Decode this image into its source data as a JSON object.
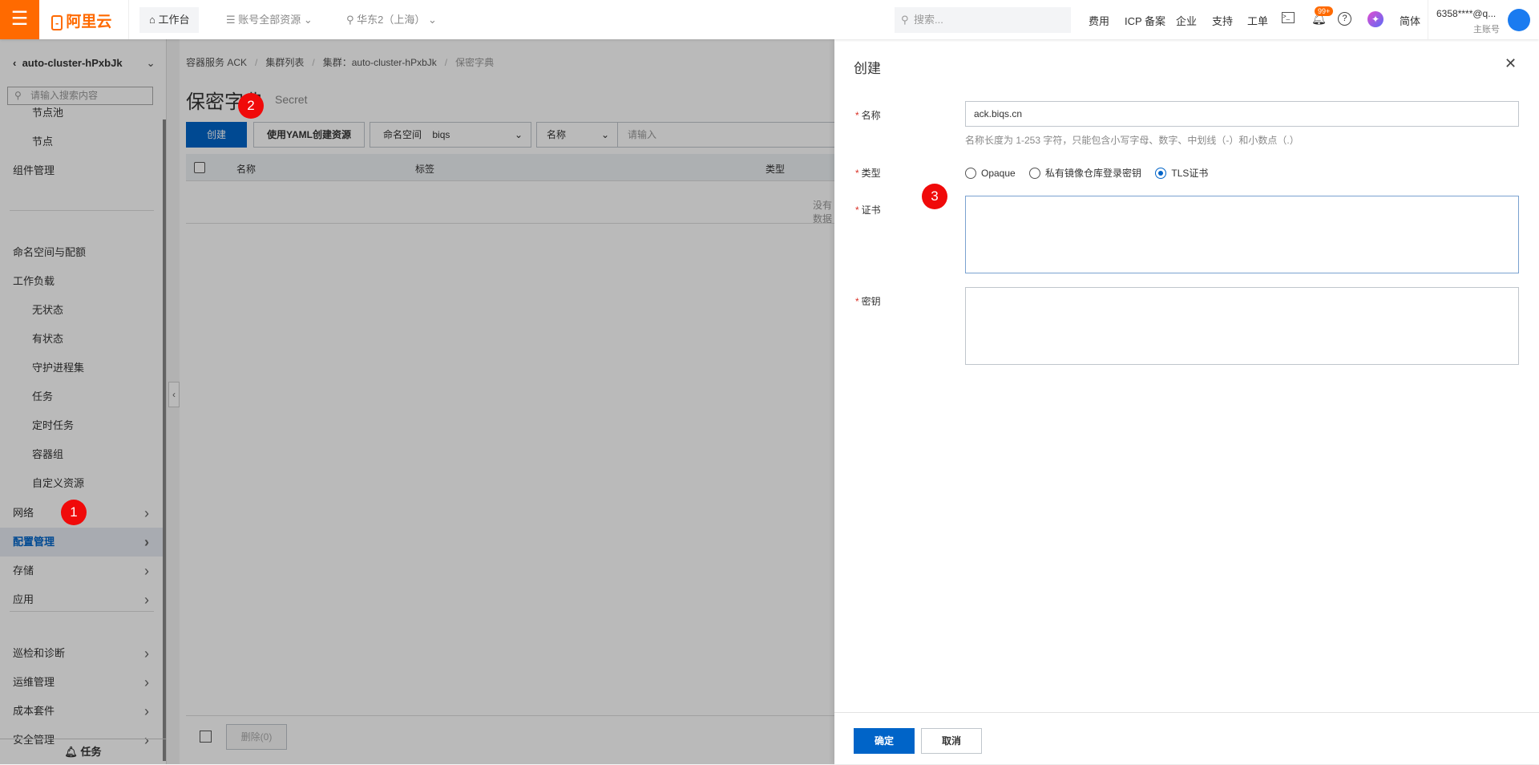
{
  "header": {
    "logo": "阿里云",
    "workbench": "工作台",
    "resources": "账号全部资源",
    "region": "华东2（上海）",
    "search_placeholder": "搜索...",
    "links": [
      "费用",
      "ICP 备案",
      "企业",
      "支持",
      "工单"
    ],
    "notif_count": "99+",
    "lang": "简体",
    "account": "6358****@q...",
    "account_type": "主账号"
  },
  "sidebar": {
    "cluster": "auto-cluster-hPxbJk",
    "search_placeholder": "请输入搜索内容",
    "items": [
      {
        "label": "节点池",
        "sub": true
      },
      {
        "label": "节点",
        "sub": true
      },
      {
        "label": "组件管理"
      },
      {
        "label": "命名空间与配额"
      },
      {
        "label": "工作负载"
      },
      {
        "label": "无状态",
        "sub": true
      },
      {
        "label": "有状态",
        "sub": true
      },
      {
        "label": "守护进程集",
        "sub": true
      },
      {
        "label": "任务",
        "sub": true
      },
      {
        "label": "定时任务",
        "sub": true
      },
      {
        "label": "容器组",
        "sub": true
      },
      {
        "label": "自定义资源",
        "sub": true
      },
      {
        "label": "网络",
        "chev": true
      },
      {
        "label": "配置管理",
        "chev": true,
        "active": true
      },
      {
        "label": "存储",
        "chev": true
      },
      {
        "label": "应用",
        "chev": true
      },
      {
        "label": "巡检和诊断",
        "chev": true
      },
      {
        "label": "运维管理",
        "chev": true
      },
      {
        "label": "成本套件",
        "chev": true
      },
      {
        "label": "安全管理",
        "chev": true
      }
    ],
    "tasks": "任务"
  },
  "main": {
    "breadcrumb": [
      "容器服务 ACK",
      "集群列表",
      "集群：auto-cluster-hPxbJk",
      "保密字典"
    ],
    "title": "保密字典",
    "subtitle": "Secret",
    "create": "创建",
    "yaml": "使用YAML创建资源",
    "ns_label": "命名空间",
    "ns_value": "biqs",
    "filter_field": "名称",
    "filter_placeholder": "请输入",
    "columns": [
      "名称",
      "标签",
      "类型"
    ],
    "empty": "没有数据",
    "delete": "删除(0)"
  },
  "drawer": {
    "title": "创建",
    "name_label": "名称",
    "name_value": "ack.biqs.cn",
    "name_hint": "名称长度为 1-253 字符，只能包含小写字母、数字、中划线（-）和小数点（.）",
    "type_label": "类型",
    "types": [
      "Opaque",
      "私有镜像仓库登录密钥",
      "TLS证书"
    ],
    "selected_type": "TLS证书",
    "cert_label": "证书",
    "key_label": "密钥",
    "ok": "确定",
    "cancel": "取消"
  },
  "annotations": [
    "1",
    "2",
    "3"
  ]
}
